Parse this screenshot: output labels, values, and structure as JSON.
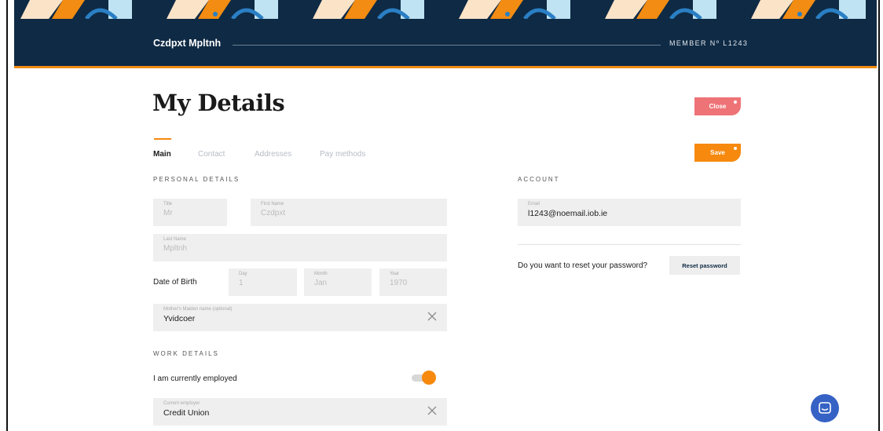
{
  "header": {
    "user_name": "Czdpxt Mpltnh",
    "member_number": "MEMBER Nº L1243"
  },
  "page": {
    "title": "My Details"
  },
  "actions": {
    "close_label": "Close",
    "save_label": "Save"
  },
  "tabs": [
    {
      "label": "Main",
      "active": true
    },
    {
      "label": "Contact",
      "active": false
    },
    {
      "label": "Addresses",
      "active": false
    },
    {
      "label": "Pay methods",
      "active": false
    }
  ],
  "personal": {
    "section_title": "PERSONAL DETAILS",
    "title": {
      "label": "Title",
      "value": "Mr"
    },
    "first_name": {
      "label": "First Name",
      "value": "Czdpxt"
    },
    "last_name": {
      "label": "Last Name",
      "value": "Mpltnh"
    },
    "dob": {
      "label": "Date of Birth",
      "day": {
        "label": "Day",
        "value": "1"
      },
      "month": {
        "label": "Month",
        "value": "Jan"
      },
      "year": {
        "label": "Year",
        "value": "1970"
      }
    },
    "maiden_name": {
      "label": "Mother's Maiden name (optional)",
      "value": "Yvidcoer"
    }
  },
  "work": {
    "section_title": "WORK DETAILS",
    "employed_label": "I am currently employed",
    "employed": true,
    "employer": {
      "label": "Current employer",
      "value": "Credit Union"
    }
  },
  "account": {
    "section_title": "ACCOUNT",
    "email": {
      "label": "Email",
      "value": "l1243@noemail.iob.ie"
    },
    "reset_question": "Do you want to reset your password?",
    "reset_label": "Reset password"
  },
  "colors": {
    "navy": "#0f2a44",
    "orange": "#f6890e",
    "coral": "#ee7377",
    "field_bg": "#efefef",
    "chat": "#3562c4"
  },
  "icons": [
    "clear-icon",
    "chat-icon"
  ]
}
